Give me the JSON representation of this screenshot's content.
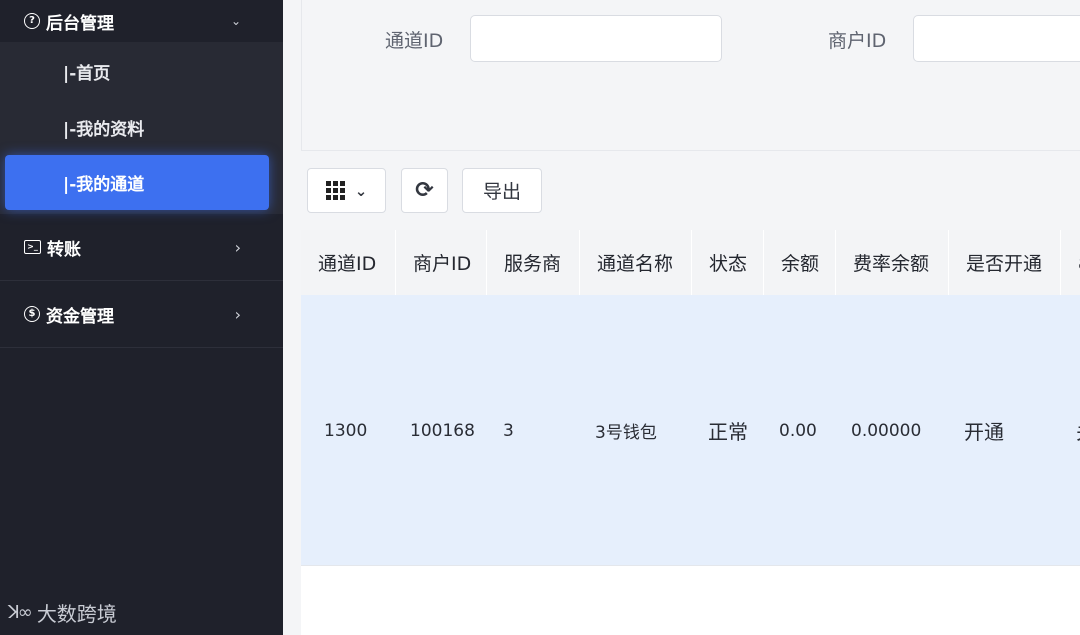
{
  "sidebar": {
    "group": {
      "label": "后台管理",
      "icon": "question-circle-icon"
    },
    "submenu": [
      {
        "label": "|-首页"
      },
      {
        "label": "|-我的资料"
      },
      {
        "label": "|-我的通道",
        "active": true
      }
    ],
    "items": [
      {
        "label": "转账",
        "icon": "terminal-icon"
      },
      {
        "label": "资金管理",
        "icon": "dollar-circle-icon"
      }
    ],
    "watermark": "大数跨境"
  },
  "filters": {
    "channel_label": "通道ID",
    "channel_value": "",
    "merchant_label": "商户ID",
    "merchant_value": ""
  },
  "toolbar": {
    "export_label": "导出"
  },
  "table": {
    "columns": [
      "通道ID",
      "商户ID",
      "服务商",
      "通道名称",
      "状态",
      "余额",
      "费率余额",
      "是否开通",
      "æ"
    ],
    "rows": [
      [
        "1300",
        "100168",
        "3",
        "3号钱包",
        "正常",
        "0.00",
        "0.00000",
        "开通",
        "关"
      ]
    ]
  },
  "colors": {
    "sidebar_bg": "#1f212b",
    "accent": "#3d70f0",
    "row_highlight": "#e6effc"
  }
}
